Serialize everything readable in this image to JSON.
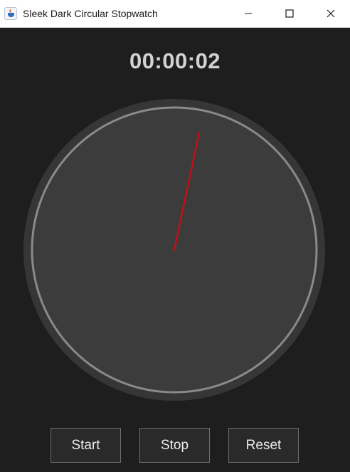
{
  "window": {
    "title": "Sleek Dark Circular Stopwatch",
    "icon": "java-cup-icon",
    "controls": [
      "minimize-icon",
      "maximize-icon",
      "close-icon"
    ]
  },
  "display": {
    "time": "00:00:02",
    "elapsed_seconds": 2
  },
  "dial": {
    "hand_color": "#c0101a",
    "face_color": "#3c3c3c",
    "rim_color": "#8a8a8a",
    "outer_color": "#363636"
  },
  "buttons": {
    "start_label": "Start",
    "stop_label": "Stop",
    "reset_label": "Reset"
  },
  "colors": {
    "background": "#1e1e1e",
    "text": "#d3d3d3"
  }
}
